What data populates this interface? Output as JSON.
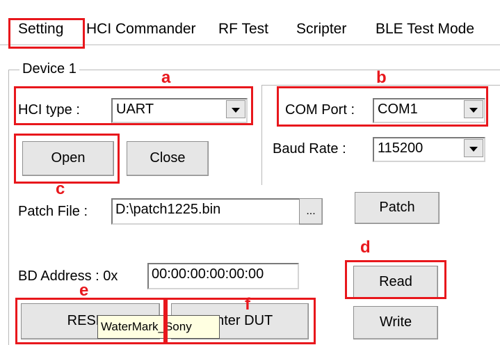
{
  "tabs": [
    {
      "label": "Setting",
      "active": true
    },
    {
      "label": "HCI Commander"
    },
    {
      "label": "RF Test"
    },
    {
      "label": "Scripter"
    },
    {
      "label": "BLE Test Mode"
    }
  ],
  "device_group": {
    "label": "Device 1"
  },
  "hci_type": {
    "label": "HCI type :",
    "value": "UART"
  },
  "com_port": {
    "label": "COM Port :",
    "value": "COM1"
  },
  "baud_rate": {
    "label": "Baud Rate :",
    "value": "115200"
  },
  "buttons": {
    "open": "Open",
    "close": "Close",
    "browse": "...",
    "patch": "Patch",
    "read": "Read",
    "reset": "RESET",
    "enter_dut": "Enter DUT",
    "write": "Write"
  },
  "patch_file": {
    "label": "Patch File :",
    "value": "D:\\patch1225.bin"
  },
  "bd_address": {
    "label": "BD Address : 0x",
    "value": "00:00:00:00:00:00"
  },
  "tooltip": "WaterMark_Sony",
  "annotations": {
    "a": "a",
    "b": "b",
    "c": "c",
    "d": "d",
    "e": "e",
    "f": "f"
  },
  "colors": {
    "annotation": "#e8171c",
    "tooltip_bg": "#ffffe1"
  }
}
